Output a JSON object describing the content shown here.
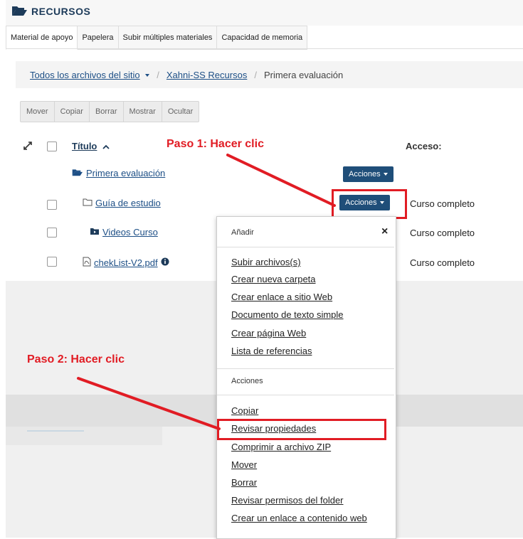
{
  "header": {
    "title": "RECURSOS",
    "icon": "folder-open-icon"
  },
  "tabs": [
    {
      "label": "Material de apoyo"
    },
    {
      "label": "Papelera"
    },
    {
      "label": "Subir múltiples materiales"
    },
    {
      "label": "Capacidad de memoria"
    }
  ],
  "breadcrumb": {
    "item0": "Todos los archivos del sitio",
    "sep": "/",
    "item1": "Xahni-SS Recursos",
    "current": "Primera evaluación"
  },
  "toolbar": {
    "move": "Mover",
    "copy": "Copiar",
    "delete": "Borrar",
    "show": "Mostrar",
    "hide": "Ocultar"
  },
  "table": {
    "col_title": "Título",
    "col_access": "Acceso:",
    "parent_folder": "Primera evaluación",
    "actions_label": "Acciones",
    "rows": [
      {
        "name": "Guía de estudio",
        "access": "Curso completo",
        "icon": "folder-outline-icon"
      },
      {
        "name": "Videos Curso",
        "access": "Curso completo",
        "icon": "video-folder-icon"
      },
      {
        "name": "chekList-V2.pdf",
        "access": "Curso completo",
        "icon": "pdf-file-icon"
      }
    ]
  },
  "dropdown": {
    "section_add": "Añadir",
    "close": "×",
    "add_items": [
      "Subir archivos(s)",
      "Crear nueva carpeta",
      "Crear enlace a sitio Web",
      "Documento de texto simple",
      "Crear página Web",
      "Lista de referencias"
    ],
    "section_actions": "Acciones",
    "action_items": [
      "Copiar",
      "Revisar propiedades",
      "Comprimir a archivo ZIP",
      "Mover",
      "Borrar",
      "Revisar permisos del folder",
      "Crear un enlace a contenido web"
    ]
  },
  "annotations": {
    "step1": "Paso 1: Hacer clic",
    "step2": "Paso 2: Hacer clic"
  },
  "colors": {
    "annotation": "#e11c24",
    "primary_button": "#1f4e79",
    "link": "#1d4f86"
  }
}
